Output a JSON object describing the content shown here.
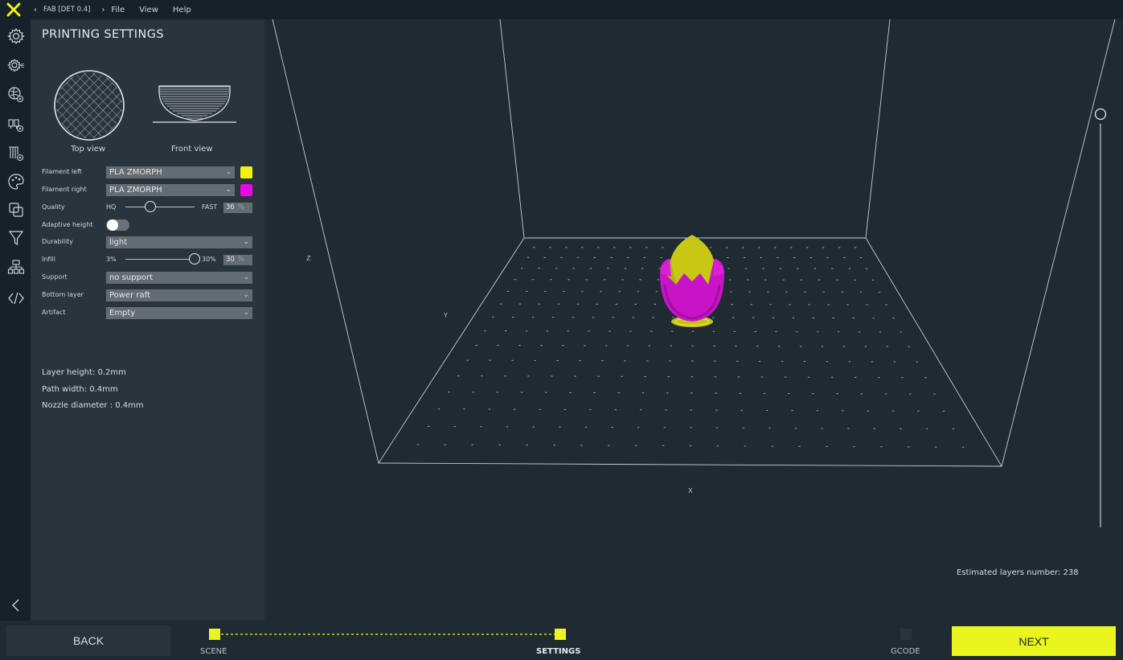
{
  "topbar": {
    "project": "FAB [DET 0.4]",
    "menu": [
      "File",
      "View",
      "Help"
    ]
  },
  "panel": {
    "title": "PRINTING SETTINGS",
    "top_view_label": "Top view",
    "front_view_label": "Front view",
    "filament_left": {
      "label": "Filament left",
      "value": "PLA ZMORPH",
      "color": "#f2f20a"
    },
    "filament_right": {
      "label": "Filament right",
      "value": "PLA ZMORPH",
      "color": "#e60ae6"
    },
    "quality": {
      "label": "Quality",
      "min_label": "HQ",
      "max_label": "FAST",
      "value": "36",
      "unit": "%",
      "level": 0.36
    },
    "adaptive_height": {
      "label": "Adaptive height",
      "on": false
    },
    "durability": {
      "label": "Durability",
      "value": "light"
    },
    "infill": {
      "label": "Infill",
      "min_label": "3%",
      "max_label": "30%",
      "value": "30",
      "unit": "%",
      "level": 1.0
    },
    "support": {
      "label": "Support",
      "value": "no support"
    },
    "bottom_layer": {
      "label": "Bottom layer",
      "value": "Power raft"
    },
    "artifact": {
      "label": "Artifact",
      "value": "Empty"
    },
    "layer_height": "Layer height: 0.2mm",
    "path_width": "Path width: 0.4mm",
    "nozzle_diameter": "Nozzle diameter : 0.4mm"
  },
  "viewport": {
    "axis_x": "X",
    "axis_y": "Y",
    "axis_z": "Z",
    "estimated_layers": "Estimated layers number: 238"
  },
  "footer": {
    "back_label": "BACK",
    "next_label": "NEXT",
    "steps": [
      {
        "label": "SCENE",
        "state": "done"
      },
      {
        "label": "SETTINGS",
        "state": "active"
      },
      {
        "label": "GCODE",
        "state": "pending"
      }
    ],
    "accent": "#eaf51d"
  }
}
